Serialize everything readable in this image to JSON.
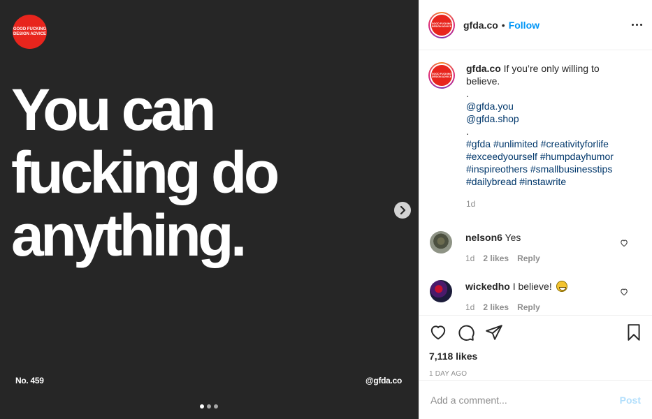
{
  "media": {
    "badge_text": "GOOD FUCKING DESIGN ADVICE",
    "headline_lines": [
      "You can",
      "fucking do",
      "anything."
    ],
    "post_number": "No. 459",
    "handle": "@gfda.co",
    "carousel": {
      "slide_count": 3,
      "active_index": 0
    },
    "next_icon": "chevron-right-icon"
  },
  "header": {
    "username": "gfda.co",
    "separator": "•",
    "follow_label": "Follow",
    "more_icon": "ellipsis-icon"
  },
  "caption": {
    "username": "gfda.co",
    "text": "If you’re only willing to believe.",
    "dot1": ".",
    "mention1": "@gfda.you",
    "mention2": "@gfda.shop",
    "dot2": ".",
    "hashtags": [
      "#gfda",
      "#unlimited",
      "#creativityforlife",
      "#exceedyourself",
      "#humpdayhumor",
      "#inspireothers",
      "#smallbusinesstips",
      "#dailybread",
      "#instawrite"
    ],
    "time": "1d"
  },
  "comments": [
    {
      "username": "nelson6",
      "text": "Yes",
      "time": "1d",
      "likes": "2 likes",
      "reply": "Reply"
    },
    {
      "username": "wickedho",
      "text": "I believe!",
      "emoji": "grinning-face",
      "time": "1d",
      "likes": "2 likes",
      "reply": "Reply"
    }
  ],
  "actions": {
    "likes": "7,118 likes",
    "time_ago": "1 DAY AGO"
  },
  "add_comment": {
    "placeholder": "Add a comment...",
    "post_label": "Post"
  },
  "colors": {
    "badge_red": "#e8251d",
    "media_bg": "#262626",
    "follow_blue": "#0095f6",
    "tag_blue": "#00376b",
    "post_disabled": "#b2dffc"
  }
}
